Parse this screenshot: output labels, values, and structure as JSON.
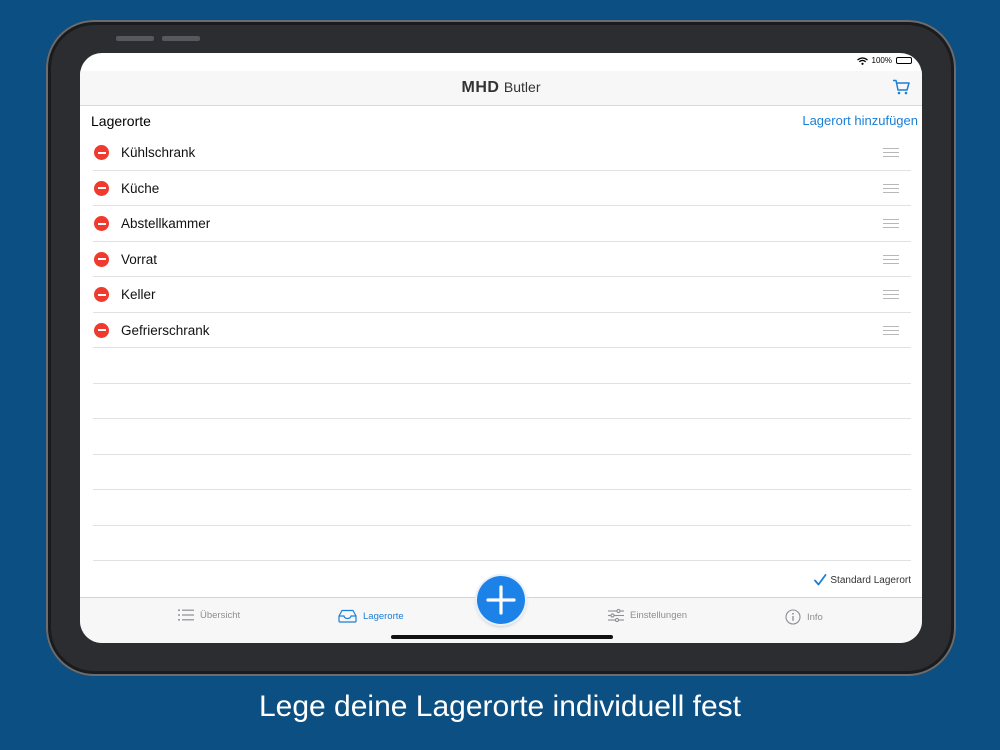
{
  "status": {
    "battery": "100%"
  },
  "header": {
    "logo_bold": "MHD",
    "logo_light": "Butler"
  },
  "section": {
    "title": "Lagerorte",
    "add_link": "Lagerort hinzufügen"
  },
  "locations": [
    {
      "name": "Kühlschrank"
    },
    {
      "name": "Küche"
    },
    {
      "name": "Abstellkammer"
    },
    {
      "name": "Vorrat"
    },
    {
      "name": "Keller"
    },
    {
      "name": "Gefrierschrank"
    }
  ],
  "footer": {
    "standard_label": "Standard Lagerort"
  },
  "tabs": [
    {
      "label": "Übersicht",
      "icon": "list-icon",
      "active": false
    },
    {
      "label": "Lagerorte",
      "icon": "tray-icon",
      "active": true
    },
    {
      "label": "Einstellungen",
      "icon": "sliders-icon",
      "active": false
    },
    {
      "label": "Info",
      "icon": "info-icon",
      "active": false
    }
  ],
  "caption": "Lege deine Lagerorte individuell fest",
  "colors": {
    "background": "#0c4f82",
    "accent": "#1b7fd6",
    "delete": "#f03a2e"
  }
}
